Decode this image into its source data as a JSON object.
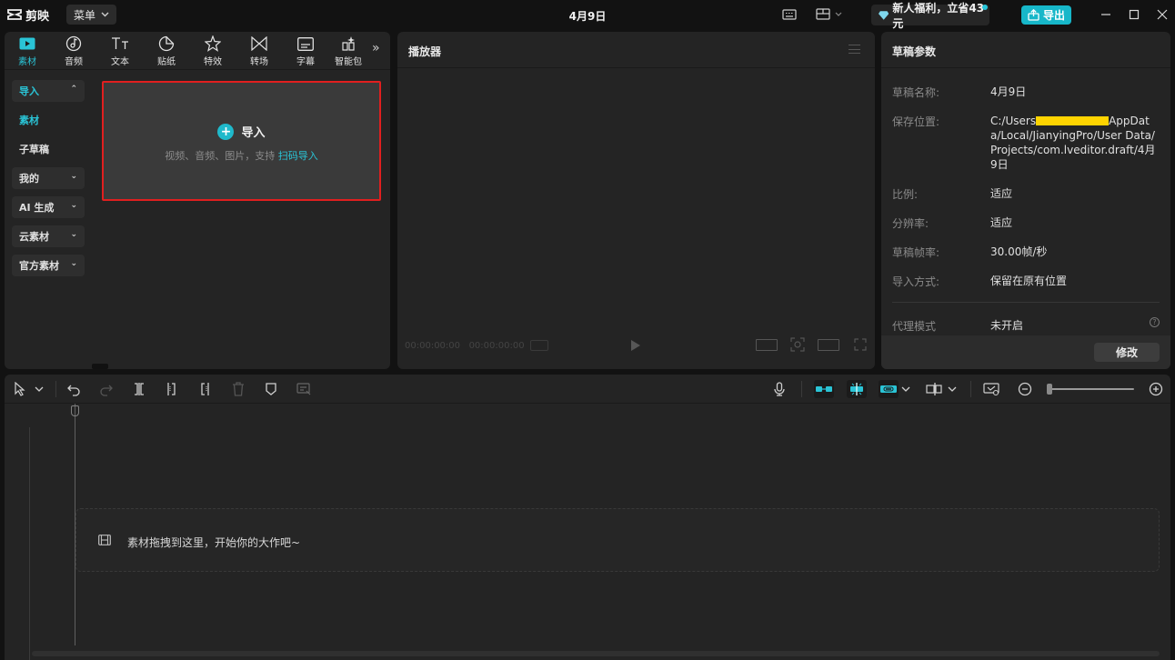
{
  "app": {
    "logo_name": "剪映",
    "menu_label": "菜单",
    "window_title": "4月9日",
    "promo_label": "新人福利，立省43元",
    "export_label": "导出"
  },
  "media_panel": {
    "tabs": [
      {
        "label": "素材",
        "icon": "media-icon",
        "active": true
      },
      {
        "label": "音频",
        "icon": "audio-icon"
      },
      {
        "label": "文本",
        "icon": "text-icon"
      },
      {
        "label": "贴纸",
        "icon": "sticker-icon"
      },
      {
        "label": "特效",
        "icon": "effects-icon"
      },
      {
        "label": "转场",
        "icon": "transition-icon"
      },
      {
        "label": "字幕",
        "icon": "subtitle-icon"
      },
      {
        "label": "智能包",
        "icon": "smart-pack-icon"
      }
    ],
    "sidebar": [
      {
        "label": "导入",
        "boxed": true,
        "expanded": true
      },
      {
        "label": "素材",
        "accent": true
      },
      {
        "label": "子草稿"
      },
      {
        "label": "我的",
        "boxed": true
      },
      {
        "label": "AI 生成",
        "boxed": true
      },
      {
        "label": "云素材",
        "boxed": true
      },
      {
        "label": "官方素材",
        "boxed": true
      }
    ],
    "import_box": {
      "title": "导入",
      "subtitle": "视频、音频、图片，支持",
      "link": "扫码导入"
    }
  },
  "player": {
    "title": "播放器",
    "current_time": "00:00:00:00",
    "total_time": "00:00:00:00"
  },
  "draft_props": {
    "title": "草稿参数",
    "rows": [
      {
        "label": "草稿名称:",
        "value": "4月9日"
      },
      {
        "label": "保存位置:",
        "value_prefix": "C:/Users",
        "value_suffix": "AppData/Local/JianyingPro/User Data/Projects/com.lveditor.draft/4月9日"
      },
      {
        "label": "比例:",
        "value": "适应"
      },
      {
        "label": "分辨率:",
        "value": "适应"
      },
      {
        "label": "草稿帧率:",
        "value": "30.00帧/秒"
      },
      {
        "label": "导入方式:",
        "value": "保留在原有位置"
      },
      {
        "label": "代理模式",
        "value": "未开启"
      }
    ],
    "modify_label": "修改"
  },
  "timeline": {
    "drop_hint": "素材拖拽到这里，开始你的大作吧~"
  },
  "colors": {
    "accent": "#2ac4d6",
    "export_bg": "#17b7c9",
    "highlight_border": "#e11f1f",
    "redaction": "#ffd400"
  }
}
